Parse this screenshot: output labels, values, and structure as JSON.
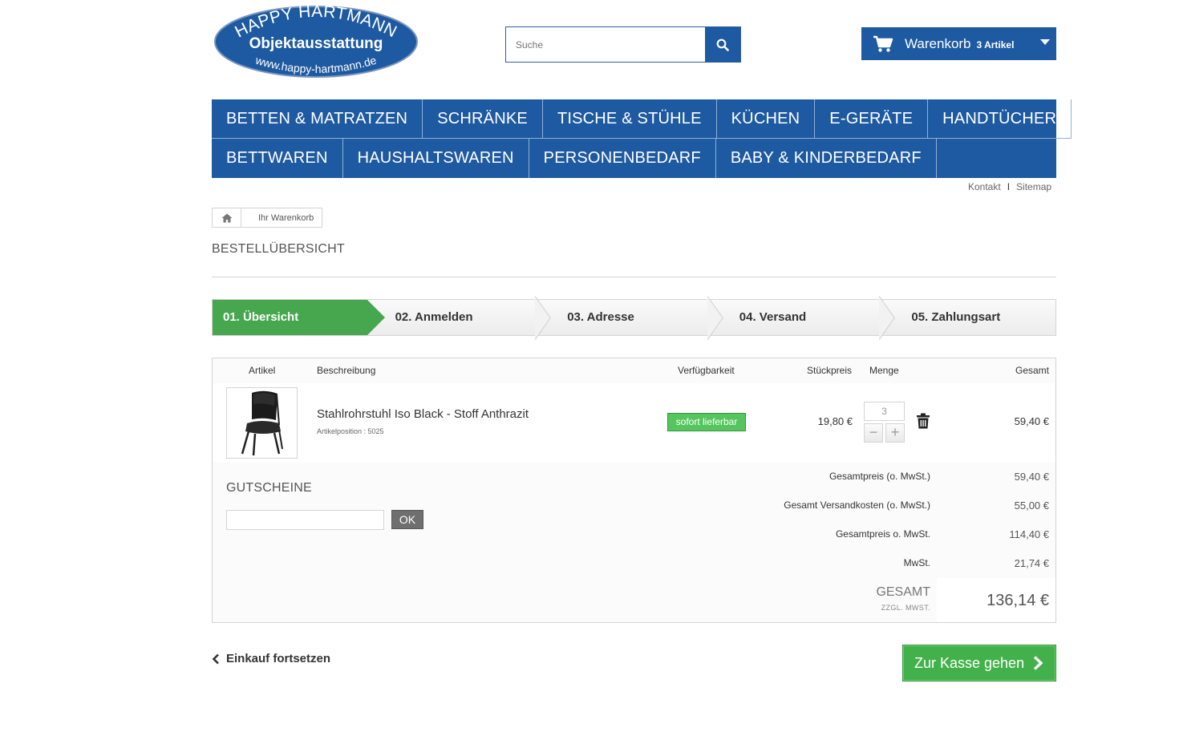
{
  "logo": {
    "line1": "HAPPY HARTMANN",
    "line2": "Objektausstattung",
    "line3": "www.happy-hartmann.de"
  },
  "search": {
    "placeholder": "Suche"
  },
  "cart": {
    "label": "Warenkorb",
    "count": "3 Artikel"
  },
  "menu": {
    "row1": [
      "BETTEN & MATRATZEN",
      "SCHRÄNKE",
      "TISCHE & STÜHLE",
      "KÜCHEN",
      "E-GERÄTE",
      "HANDTÜCHER"
    ],
    "row2": [
      "BETTWAREN",
      "HAUSHALTSWAREN",
      "PERSONENBEDARF",
      "BABY & KINDERBEDARF"
    ]
  },
  "toplinks": {
    "contact": "Kontakt",
    "separator": "I",
    "sitemap": "Sitemap"
  },
  "breadcrumb": {
    "current": "Ihr Warenkorb"
  },
  "page": {
    "heading": "BESTELLÜBERSICHT"
  },
  "steps": [
    "01. Übersicht",
    "02. Anmelden",
    "03. Adresse",
    "04. Versand",
    "05. Zahlungsart"
  ],
  "table": {
    "headers": {
      "article": "Artikel",
      "description": "Beschreibung",
      "availability": "Verfügbarkeit",
      "unit_price": "Stückpreis",
      "quantity": "Menge",
      "total": "Gesamt"
    },
    "items": [
      {
        "name": "Stahlrohrstuhl Iso Black - Stoff Anthrazit",
        "reference": "Artikelposition : 5025",
        "availability": "sofort lieferbar",
        "unit_price": "19,80 €",
        "quantity": "3",
        "total": "59,40 €"
      }
    ]
  },
  "voucher": {
    "title": "GUTSCHEINE",
    "button": "OK"
  },
  "summary": {
    "subtotal_label": "Gesamtpreis (o. MwSt.)",
    "subtotal_value": "59,40 €",
    "shipping_label": "Gesamt Versandkosten (o. MwSt.)",
    "shipping_value": "55,00 €",
    "net_label": "Gesamtpreis o. MwSt.",
    "net_value": "114,40 €",
    "tax_label": "MwSt.",
    "tax_value": "21,74 €",
    "total_label": "GESAMT",
    "total_sub": "ZZGL. MWST.",
    "total_value": "136,14 €"
  },
  "actions": {
    "continue": "Einkauf fortsetzen",
    "checkout": "Zur Kasse gehen"
  },
  "colors": {
    "brand_blue": "#1e5aa1",
    "success_green": "#46a74e"
  }
}
